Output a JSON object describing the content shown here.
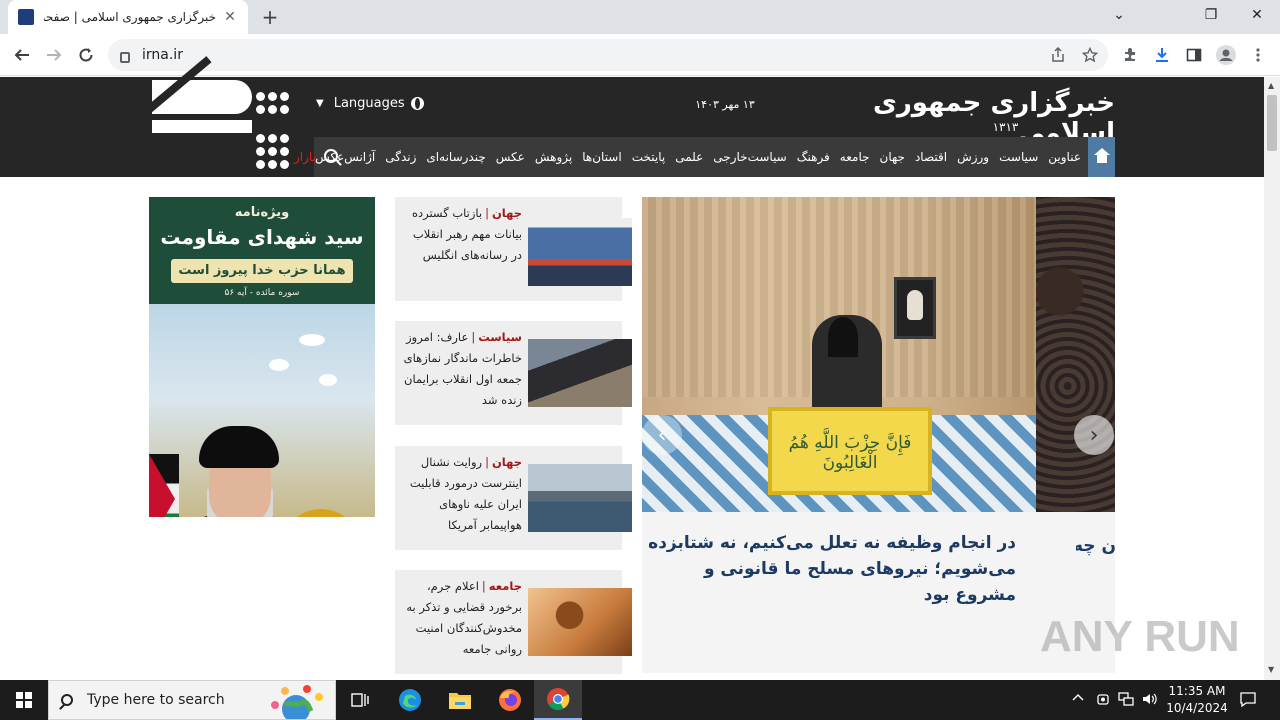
{
  "browser": {
    "tab_title": "خبرگزاری جمهوری اسلامی | صفحه اول",
    "tab_close": "✕",
    "new_tab": "+",
    "url": "irna.ir",
    "window_controls": {
      "minimize": "⌄",
      "restore": "❐",
      "close": "✕"
    }
  },
  "site": {
    "title": "خبرگزاری جمهوری اسلامی",
    "title_year": "۱۳۱۳",
    "date": "۱۳ مهر ۱۴۰۳",
    "languages_label": "Languages",
    "nav": [
      "عناوین",
      "سیاست",
      "ورزش",
      "اقتصاد",
      "جهان",
      "جامعه",
      "فرهنگ",
      "سیاست‌خارجی",
      "علمی",
      "پایتخت",
      "استان‌ها",
      "پژوهش",
      "عکس",
      "چندرسانه‌ای",
      "زندگی",
      "آژانس‌عکس"
    ],
    "bazaar": "بازار"
  },
  "banner": {
    "line1": "ویژه‌نامه",
    "line2": "سید شهدای مقاومت",
    "line3": "همانا حزب خدا پیروز است",
    "line4": "سوره مائده - آیه ۵۶"
  },
  "news": [
    {
      "category": "جهان",
      "separator": "|",
      "text": "بازتاب گسترده بیانات مهم رهبر انقلاب در رسانه‌های انگلیس"
    },
    {
      "category": "سیاست",
      "separator": "|",
      "text": "عارف: امروز خاطرات ماندگار نمازهای جمعه اول انقلاب برایمان زنده شد"
    },
    {
      "category": "جهان",
      "separator": "|",
      "text": "روایت نشنال اینترست درمورد قابلیت ایران علیه ناوهای هواپیمابر آمریکا"
    },
    {
      "category": "جامعه",
      "separator": "|",
      "text": "اعلام جرم، برخورد قضایی و تذکر به مخدوش‌کنندگان امنیت روانی جامعه"
    }
  ],
  "slider": {
    "podium_text": "فَإِنَّ حِزْبَ اللَّهِ هُمُ الْغَالِبُونَ",
    "headline": "در انجام وظیفه نه تعلل می‌کنیم، نه شتابزده می‌شویم؛ نیروهای مسلح ما قانونی و مشروع بود",
    "headline_next": "ن چه",
    "prev": "‹",
    "next": "›"
  },
  "watermark": "ANY RUN",
  "taskbar": {
    "search_placeholder": "Type here to search",
    "time": "11:35 AM",
    "date": "10/4/2024"
  }
}
